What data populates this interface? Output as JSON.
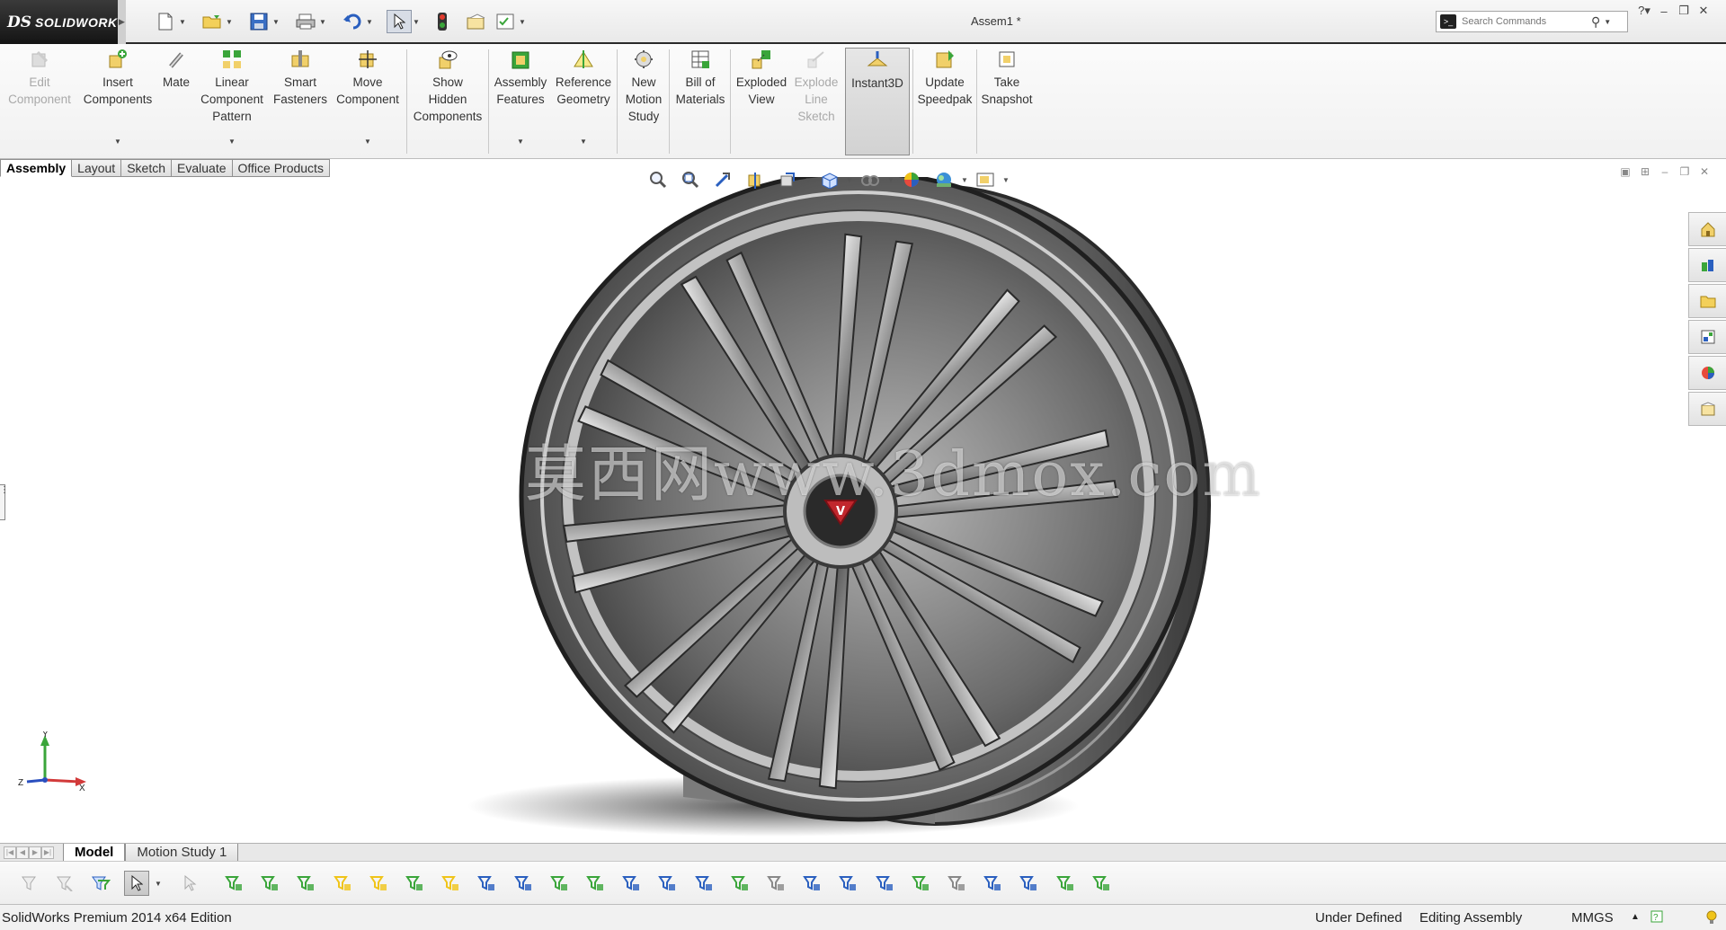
{
  "app": {
    "brand_mark": "DS",
    "brand_name": "SOLIDWORKS",
    "document_title": "Assem1 *"
  },
  "search": {
    "placeholder": "Search Commands"
  },
  "ribbon": {
    "commands": [
      {
        "id": "edit-component",
        "label": "Edit\nComponent",
        "enabled": false,
        "icon": "edit-component-icon"
      },
      {
        "id": "insert-components",
        "label": "Insert\nComponents",
        "enabled": true,
        "dropdown": true,
        "icon": "insert-components-icon"
      },
      {
        "id": "mate",
        "label": "Mate",
        "enabled": true,
        "icon": "mate-icon"
      },
      {
        "id": "linear-component-pattern",
        "label": "Linear\nComponent\nPattern",
        "enabled": true,
        "dropdown": true,
        "icon": "linear-pattern-icon"
      },
      {
        "id": "smart-fasteners",
        "label": "Smart\nFasteners",
        "enabled": true,
        "icon": "smart-fasteners-icon"
      },
      {
        "id": "move-component",
        "label": "Move\nComponent",
        "enabled": true,
        "dropdown": true,
        "icon": "move-component-icon"
      },
      {
        "id": "show-hidden-components",
        "label": "Show\nHidden\nComponents",
        "enabled": true,
        "icon": "show-hidden-icon"
      },
      {
        "id": "assembly-features",
        "label": "Assembly\nFeatures",
        "enabled": true,
        "dropdown": true,
        "icon": "assembly-features-icon"
      },
      {
        "id": "reference-geometry",
        "label": "Reference\nGeometry",
        "enabled": true,
        "dropdown": true,
        "icon": "reference-geometry-icon"
      },
      {
        "id": "new-motion-study",
        "label": "New\nMotion\nStudy",
        "enabled": true,
        "icon": "motion-study-icon"
      },
      {
        "id": "bill-of-materials",
        "label": "Bill of\nMaterials",
        "enabled": true,
        "icon": "bill-of-materials-icon"
      },
      {
        "id": "exploded-view",
        "label": "Exploded\nView",
        "enabled": true,
        "icon": "exploded-view-icon"
      },
      {
        "id": "explode-line-sketch",
        "label": "Explode\nLine\nSketch",
        "enabled": false,
        "icon": "explode-line-icon"
      },
      {
        "id": "instant3d",
        "label": "Instant3D",
        "enabled": true,
        "active": true,
        "icon": "instant3d-icon"
      },
      {
        "id": "update-speedpak",
        "label": "Update\nSpeedpak",
        "enabled": true,
        "icon": "speedpak-icon"
      },
      {
        "id": "take-snapshot",
        "label": "Take\nSnapshot",
        "enabled": true,
        "icon": "snapshot-icon"
      }
    ]
  },
  "tabs": [
    {
      "label": "Assembly",
      "active": true
    },
    {
      "label": "Layout",
      "active": false
    },
    {
      "label": "Sketch",
      "active": false
    },
    {
      "label": "Evaluate",
      "active": false
    },
    {
      "label": "Office Products",
      "active": false
    }
  ],
  "watermark": "莫西网www.3dmox.com",
  "emblem": "V",
  "triad": {
    "y": "Y",
    "z": "Z",
    "x": "X"
  },
  "bottom_tabs": [
    {
      "label": "Model",
      "active": true
    },
    {
      "label": "Motion Study 1",
      "active": false
    }
  ],
  "status": {
    "product": "SolidWorks Premium 2014 x64 Edition",
    "definition": "Under Defined",
    "mode": "Editing Assembly",
    "units": "MMGS"
  },
  "colors": {
    "accent_green": "#3aa53a",
    "accent_yellow": "#f0c419",
    "title_underline": "#2a2a2a",
    "brand_bg": "#1b1b1b"
  }
}
